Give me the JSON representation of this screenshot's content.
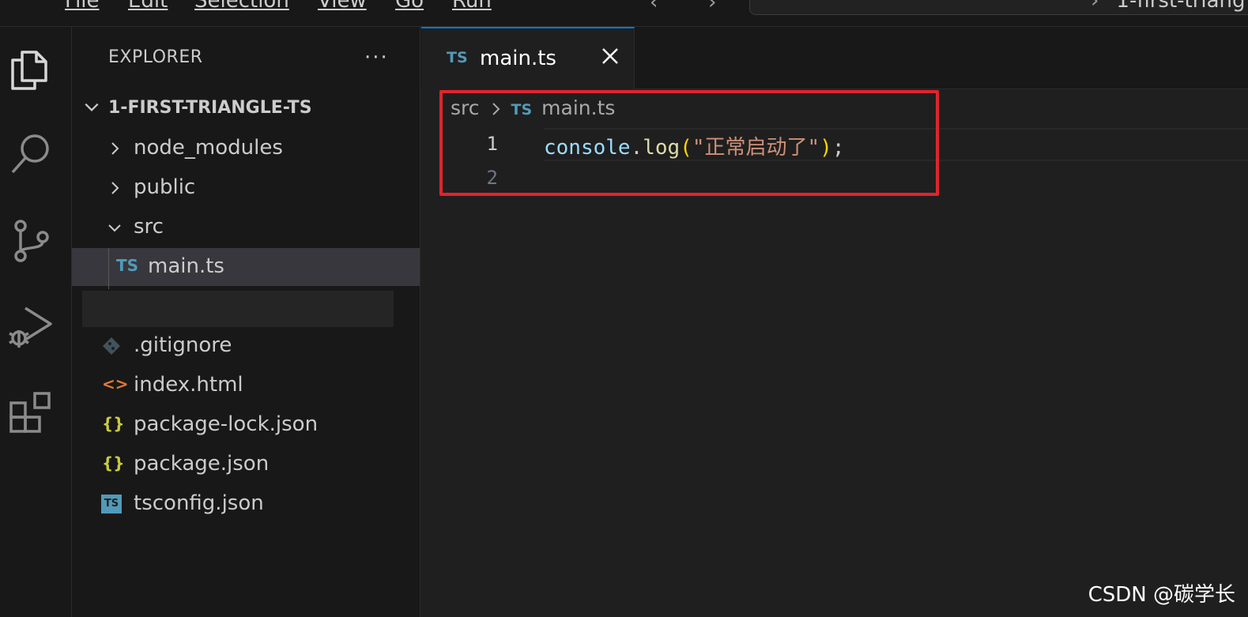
{
  "menu": {
    "items": [
      "File",
      "Edit",
      "Selection",
      "View",
      "Go",
      "Run"
    ],
    "command_center_text": "1-first-triang"
  },
  "activity_bar": {
    "icons": [
      "explorer-icon",
      "search-icon",
      "source-control-icon",
      "run-debug-icon",
      "extensions-icon"
    ]
  },
  "sidebar": {
    "title": "EXPLORER",
    "more_actions": "···",
    "folder_name": "1-FIRST-TRIANGLE-TS",
    "tree": [
      {
        "label": "node_modules",
        "type": "folder",
        "expanded": false
      },
      {
        "label": "public",
        "type": "folder",
        "expanded": false
      },
      {
        "label": "src",
        "type": "folder",
        "expanded": true
      },
      {
        "label": "main.ts",
        "type": "ts",
        "icon_text": "TS",
        "selected": true
      },
      {
        "label": ".gitignore",
        "type": "git"
      },
      {
        "label": "index.html",
        "type": "html",
        "icon_text": "<>"
      },
      {
        "label": "package-lock.json",
        "type": "json",
        "icon_text": "{}"
      },
      {
        "label": "package.json",
        "type": "json",
        "icon_text": "{}"
      },
      {
        "label": "tsconfig.json",
        "type": "tsconfig",
        "icon_text": "TS"
      }
    ]
  },
  "editor": {
    "tab": {
      "icon_text": "TS",
      "label": "main.ts"
    },
    "breadcrumb": {
      "folder": "src",
      "icon_text": "TS",
      "file": "main.ts"
    },
    "line_numbers": [
      "1",
      "2"
    ],
    "code": {
      "object": "console",
      "dot": ".",
      "method": "log",
      "open_paren": "(",
      "string": "\"正常启动了\"",
      "close_paren": ")",
      "semicolon": ";"
    }
  },
  "watermark": "CSDN @碳学长",
  "colors": {
    "accent": "#0078d4",
    "highlight_box": "#e0242d",
    "ts_icon": "#519aba",
    "json_icon": "#cbcb41",
    "html_icon": "#e37933"
  }
}
